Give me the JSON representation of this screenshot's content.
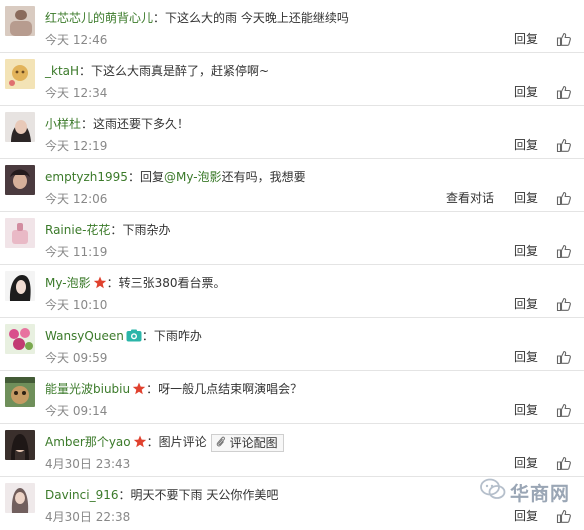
{
  "comments": [
    {
      "user": "红芯芯儿的萌背心儿",
      "text": "下这么大的雨 今天晚上还能继续吗",
      "time": "今天 12:46",
      "reply": "回复"
    },
    {
      "user": "_ktaH",
      "text": "下这么大雨真是醉了，赶紧停啊~",
      "time": "今天 12:34",
      "reply": "回复"
    },
    {
      "user": "小样杜",
      "text": "这雨还要下多久！",
      "time": "今天 12:19",
      "reply": "回复"
    },
    {
      "user": "emptyzh1995",
      "text_prefix": "回复",
      "at": "@My-泡影",
      "text": "还有吗，我想要",
      "time": "今天 12:06",
      "reply": "回复",
      "view_convo": "查看对话"
    },
    {
      "user": "Rainie-花花",
      "text": "下雨杂办",
      "time": "今天 11:19",
      "reply": "回复"
    },
    {
      "user": "My-泡影",
      "text": "转三张380看台票。",
      "time": "今天 10:10",
      "reply": "回复",
      "badge": "star-badge-icon"
    },
    {
      "user": "WansyQueen",
      "text": "下雨咋办",
      "time": "今天 09:59",
      "reply": "回复",
      "badge": "camera-badge-icon"
    },
    {
      "user": "能量光波biubiu",
      "text": "呀一般几点结束啊演唱会？",
      "time": "今天 09:14",
      "reply": "回复",
      "badge": "star-badge-icon"
    },
    {
      "user": "Amber那个yao",
      "text": "图片评论",
      "pic_button": "评论配图",
      "time": "4月30日 23:43",
      "reply": "回复",
      "badge": "star-badge-icon"
    },
    {
      "user": "Davinci_916",
      "text": "明天不要下雨 天公你作美吧",
      "time": "4月30日 22:38",
      "reply": "回复"
    }
  ],
  "separator": "：",
  "watermark": "华商网",
  "colors": {
    "username": "#3b7a2a",
    "time": "#888888",
    "divider": "#e4e4e4",
    "star": "#e0412e",
    "camera": "#2bb5a8"
  }
}
